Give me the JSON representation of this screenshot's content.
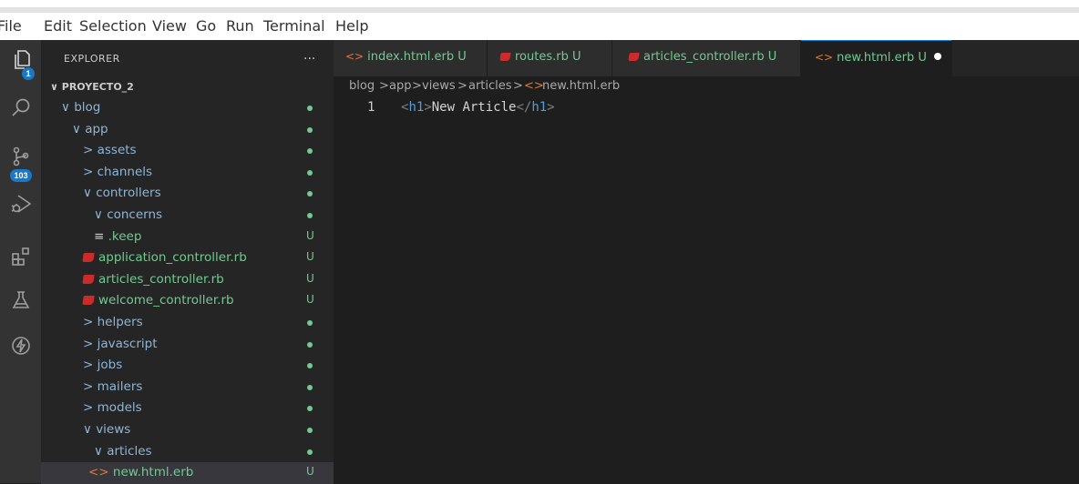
{
  "menu": [
    "File",
    "Edit",
    "Selection",
    "View",
    "Go",
    "Run",
    "Terminal",
    "Help"
  ],
  "activity_bar": {
    "explorer_badge": "1",
    "source_control_badge": "103",
    "icons": [
      "files-icon",
      "search-icon",
      "source-control-icon",
      "run-debug-icon",
      "extensions-icon",
      "testing-icon",
      "lightning-icon"
    ]
  },
  "explorer": {
    "title": "EXPLORER",
    "more": "...",
    "project": "PROYECTO_2",
    "tree": [
      {
        "label": "blog",
        "chevron": "∨",
        "status": "dot"
      },
      {
        "label": "app",
        "chevron": "∨",
        "status": "dot"
      },
      {
        "label": "assets",
        "chevron": ">",
        "status": "dot"
      },
      {
        "label": "channels",
        "chevron": ">",
        "status": "dot"
      },
      {
        "label": "controllers",
        "chevron": "∨",
        "status": "dot"
      },
      {
        "label": "concerns",
        "chevron": "∨",
        "status": "dot"
      },
      {
        "label": ".keep",
        "icon": "≡",
        "status": "U"
      },
      {
        "label": "application_controller.rb",
        "icon": "ruby",
        "status": "U"
      },
      {
        "label": "articles_controller.rb",
        "icon": "ruby",
        "status": "U"
      },
      {
        "label": "welcome_controller.rb",
        "icon": "ruby",
        "status": "U"
      },
      {
        "label": "helpers",
        "chevron": ">",
        "status": "dot"
      },
      {
        "label": "javascript",
        "chevron": ">",
        "status": "dot"
      },
      {
        "label": "jobs",
        "chevron": ">",
        "status": "dot"
      },
      {
        "label": "mailers",
        "chevron": ">",
        "status": "dot"
      },
      {
        "label": "models",
        "chevron": ">",
        "status": "dot"
      },
      {
        "label": "views",
        "chevron": "∨",
        "status": "dot"
      },
      {
        "label": "articles",
        "chevron": "∨",
        "status": "dot"
      },
      {
        "label": "new.html.erb",
        "icon": "code",
        "status": "U"
      }
    ]
  },
  "tabs": [
    {
      "label": "index.html.erb",
      "suffix": "U",
      "icon": "code"
    },
    {
      "label": "routes.rb",
      "suffix": "U",
      "icon": "ruby"
    },
    {
      "label": "articles_controller.rb",
      "suffix": "U",
      "icon": "ruby"
    },
    {
      "label": "new.html.erb",
      "suffix": "U",
      "icon": "code",
      "active": true,
      "dirty": true
    }
  ],
  "breadcrumb": [
    "blog",
    "app",
    "views",
    "articles",
    "new.html.erb"
  ],
  "editor": {
    "line_number": "1",
    "code": {
      "open_lt": "<",
      "open_tag": "h1",
      "open_gt": ">",
      "text": "New Article",
      "close_lt": "</",
      "close_tag": "h1",
      "close_gt": ">"
    }
  },
  "colors": {
    "untracked_green": "#73c991",
    "folder_blue": "#8cb6d8",
    "accent_blue": "#1c77c4",
    "ruby_red": "#cc2b2b",
    "html_orange": "#e37933"
  }
}
